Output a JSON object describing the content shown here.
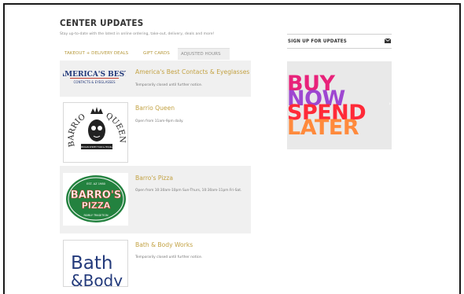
{
  "section": {
    "title": "CENTER UPDATES",
    "subtitle": "Stay up-to-date with the latest in online ordering, take-out, delivery, deals and more!"
  },
  "tabs": [
    {
      "label": "TAKEOUT + DELIVERY DEALS",
      "active": false
    },
    {
      "label": "GIFT CARDS",
      "active": false
    },
    {
      "label": "ADJUSTED HOURS",
      "active": true
    }
  ],
  "stores": [
    {
      "name": "America's Best Contacts & Eyeglasses",
      "hours": "Temporarily closed until further notice.",
      "logo": {
        "line1": "AMERICA'S BEST",
        "line2": "CONTACTS & EYEGLASSES"
      }
    },
    {
      "name": "Barrio Queen",
      "hours": "Open from 11am-9pm daily.",
      "logo": {
        "left": "BARRIO",
        "right": "QUEEN",
        "ribbon": "MEXICAN STREET FOOD & TEQUILA"
      }
    },
    {
      "name": "Barro's Pizza",
      "hours": "Open from 10:30am-10pm Sun-Thurs, 10:30am-11pm Fri-Sat.",
      "logo": {
        "top": "EST. AZ 1980",
        "line1": "BARRO'S",
        "line2": "PIZZA",
        "bottom": "FAMILY TRADITION"
      }
    },
    {
      "name": "Bath & Body Works",
      "hours": "Temporarily closed until further notice.",
      "logo": {
        "line1": "Bath",
        "line2": "&Body"
      }
    }
  ],
  "sidebar": {
    "signup_label": "SIGN UP FOR UPDATES",
    "icon": "mail-icon",
    "promo": {
      "line1": "BUY",
      "line2": "NOW",
      "line3": "SPEND",
      "line4": "LATER"
    }
  },
  "colors": {
    "accent_gold": "#c3a243",
    "tab_gold": "#b79a3e",
    "promo_magenta": "#e8227a",
    "promo_purple": "#8b3fd8",
    "promo_red": "#ff2a38",
    "promo_orange": "#ff8a3c",
    "barros_green": "#23823f",
    "barros_red": "#d93a2b",
    "americas_blue": "#233a7b"
  }
}
